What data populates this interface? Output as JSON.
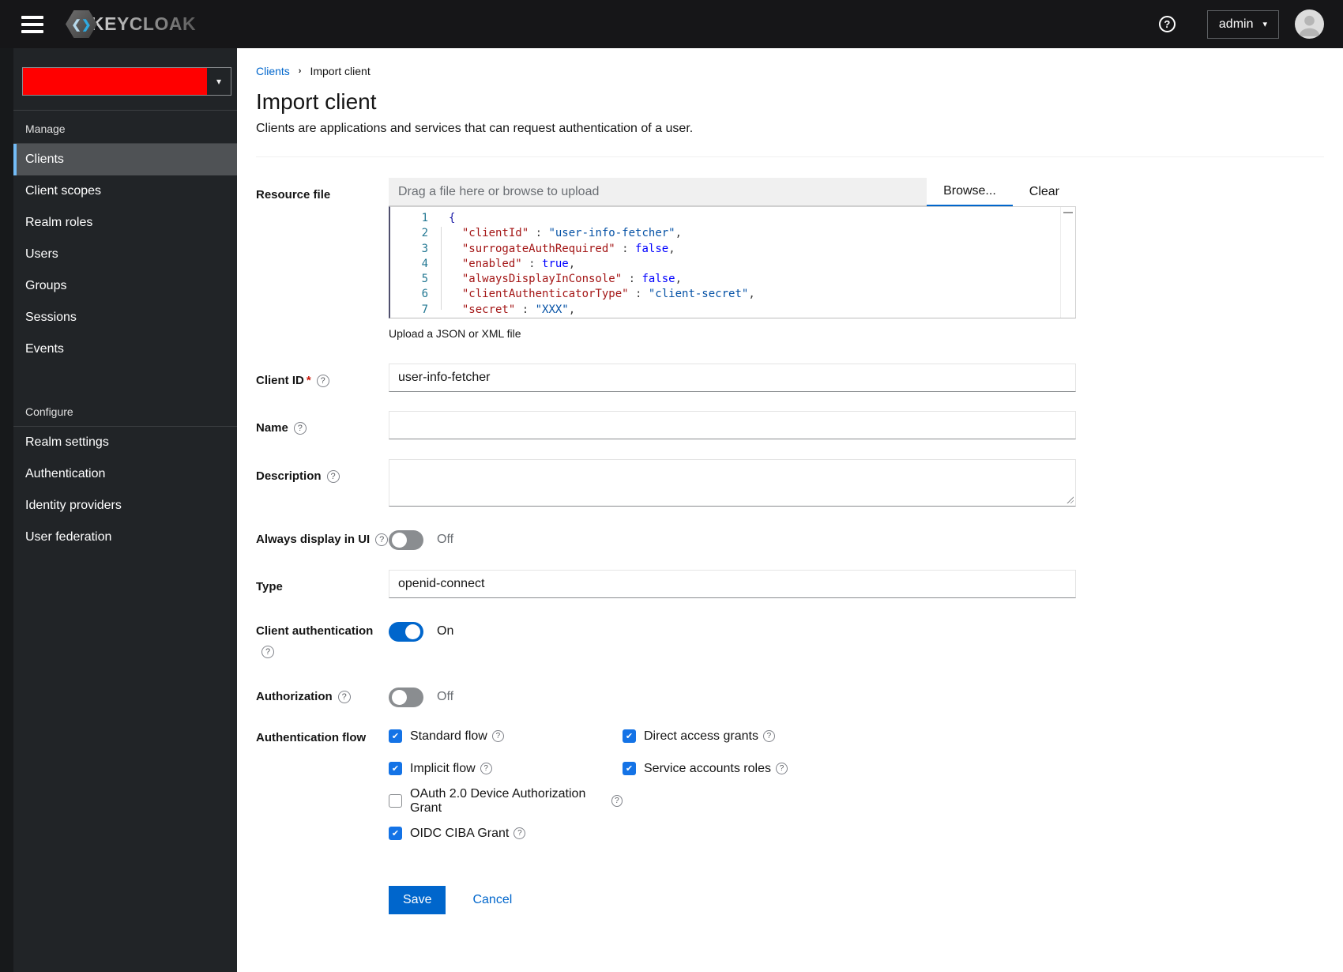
{
  "colors": {
    "primary": "#0066cc",
    "checkbox_checked": "#1473e6",
    "realm_mask": "#ff0000",
    "nav_active_border": "#73bcf7",
    "masthead_bg": "#161618",
    "sidebar_bg": "#212427"
  },
  "icons": {
    "help": "?",
    "caret": "▾",
    "check": "✔",
    "breadcrumb_sep": "›",
    "chev_left": "❮",
    "chev_right": "❯"
  },
  "masthead": {
    "brand": "KEYCLOAK",
    "user": "admin"
  },
  "sidebar": {
    "realm_selector": {
      "masked": true,
      "mask_color": "#ff0000"
    },
    "sections": [
      {
        "label": "Manage",
        "items": [
          {
            "label": "Clients",
            "active": true
          },
          {
            "label": "Client scopes",
            "active": false
          },
          {
            "label": "Realm roles",
            "active": false
          },
          {
            "label": "Users",
            "active": false
          },
          {
            "label": "Groups",
            "active": false
          },
          {
            "label": "Sessions",
            "active": false
          },
          {
            "label": "Events",
            "active": false
          }
        ]
      },
      {
        "label": "Configure",
        "items": [
          {
            "label": "Realm settings",
            "active": false
          },
          {
            "label": "Authentication",
            "active": false
          },
          {
            "label": "Identity providers",
            "active": false
          },
          {
            "label": "User federation",
            "active": false
          }
        ]
      }
    ]
  },
  "breadcrumb": {
    "items": [
      "Clients",
      "Import client"
    ]
  },
  "page": {
    "title": "Import client",
    "subtitle": "Clients are applications and services that can request authentication of a user."
  },
  "form": {
    "resource_file": {
      "label": "Resource file",
      "placeholder": "Drag a file here or browse to upload",
      "browse_label": "Browse...",
      "clear_label": "Clear",
      "helper": "Upload a JSON or XML file",
      "code_lines": [
        {
          "num": "1",
          "segments": [
            [
              "brace",
              "{"
            ]
          ]
        },
        {
          "num": "2",
          "segments": [
            [
              "plain",
              "  "
            ],
            [
              "key",
              "\"clientId\""
            ],
            [
              "plain",
              " : "
            ],
            [
              "str",
              "\"user-info-fetcher\""
            ],
            [
              "plain",
              ","
            ]
          ]
        },
        {
          "num": "3",
          "segments": [
            [
              "plain",
              "  "
            ],
            [
              "key",
              "\"surrogateAuthRequired\""
            ],
            [
              "plain",
              " : "
            ],
            [
              "bool",
              "false"
            ],
            [
              "plain",
              ","
            ]
          ]
        },
        {
          "num": "4",
          "segments": [
            [
              "plain",
              "  "
            ],
            [
              "key",
              "\"enabled\""
            ],
            [
              "plain",
              " : "
            ],
            [
              "bool",
              "true"
            ],
            [
              "plain",
              ","
            ]
          ]
        },
        {
          "num": "5",
          "segments": [
            [
              "plain",
              "  "
            ],
            [
              "key",
              "\"alwaysDisplayInConsole\""
            ],
            [
              "plain",
              " : "
            ],
            [
              "bool",
              "false"
            ],
            [
              "plain",
              ","
            ]
          ]
        },
        {
          "num": "6",
          "segments": [
            [
              "plain",
              "  "
            ],
            [
              "key",
              "\"clientAuthenticatorType\""
            ],
            [
              "plain",
              " : "
            ],
            [
              "str",
              "\"client-secret\""
            ],
            [
              "plain",
              ","
            ]
          ]
        },
        {
          "num": "7",
          "segments": [
            [
              "plain",
              "  "
            ],
            [
              "key",
              "\"secret\""
            ],
            [
              "plain",
              " : "
            ],
            [
              "str",
              "\"XXX\""
            ],
            [
              "plain",
              ","
            ]
          ]
        }
      ]
    },
    "client_id": {
      "label": "Client ID",
      "required_mark": "*",
      "value": "user-info-fetcher"
    },
    "name": {
      "label": "Name",
      "value": ""
    },
    "description": {
      "label": "Description",
      "value": ""
    },
    "always_display": {
      "label": "Always display in UI",
      "on": false,
      "state": "Off"
    },
    "type": {
      "label": "Type",
      "value": "openid-connect"
    },
    "client_auth": {
      "label": "Client authentication",
      "on": true,
      "state": "On"
    },
    "authorization": {
      "label": "Authorization",
      "on": false,
      "state": "Off"
    },
    "auth_flow": {
      "label": "Authentication flow",
      "options": [
        {
          "label": "Standard flow",
          "checked": true,
          "col": 1
        },
        {
          "label": "Direct access grants",
          "checked": true,
          "col": 2
        },
        {
          "label": "Implicit flow",
          "checked": true,
          "col": 1
        },
        {
          "label": "Service accounts roles",
          "checked": true,
          "col": 2
        },
        {
          "label": "OAuth 2.0 Device Authorization Grant",
          "checked": false,
          "col": 1
        },
        {
          "label": "OIDC CIBA Grant",
          "checked": true,
          "col": 1
        }
      ]
    }
  },
  "actions": {
    "save": "Save",
    "cancel": "Cancel"
  }
}
